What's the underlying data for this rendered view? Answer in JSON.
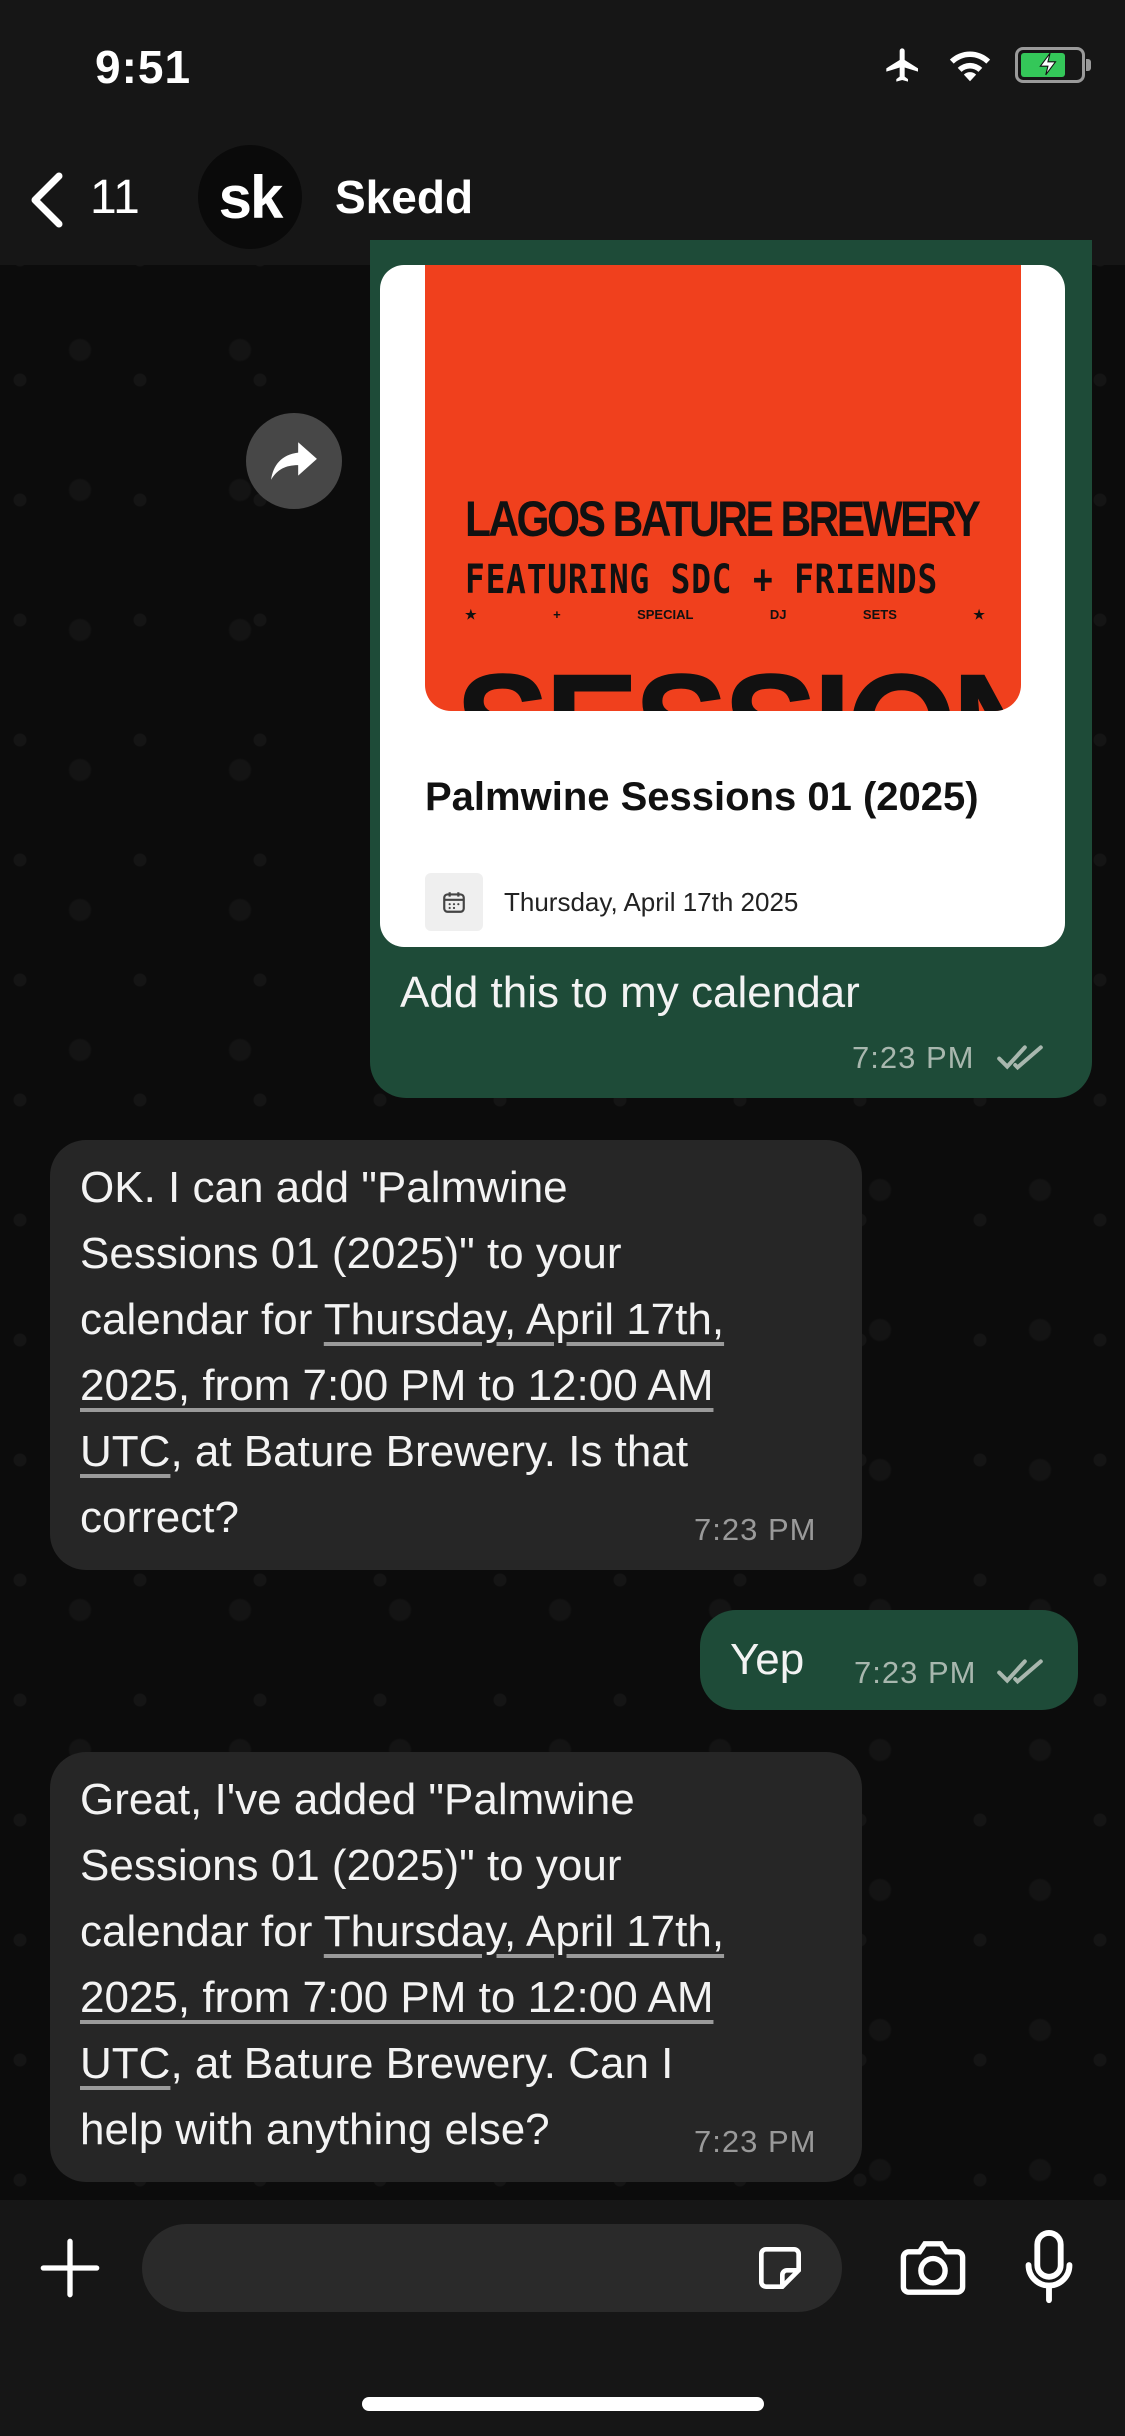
{
  "status_bar": {
    "time": "9:51"
  },
  "header": {
    "back_count": "11",
    "avatar_text": "sk",
    "contact_name": "Skedd"
  },
  "event_card": {
    "poster_lines": [
      "LAGOS BATURE BREWERY",
      "FEATURING SDC + FRIENDS",
      "SESSIONS"
    ],
    "poster_small": [
      "★",
      "+",
      "SPECIAL",
      "DJ",
      "SETS",
      "★"
    ],
    "title": "Palmwine Sessions 01 (2025)",
    "date": "Thursday, April 17th 2025"
  },
  "messages": [
    {
      "direction": "out",
      "text": "Add this to my calendar",
      "time": "7:23 PM"
    },
    {
      "direction": "in",
      "lines": [
        "OK. I can add \"Palmwine",
        "Sessions 01 (2025)\" to your",
        "calendar for ",
        "Thursday, April 17th,",
        "2025, from 7:00 PM to 12:00 AM",
        "UTC",
        ", at Bature Brewery. Is that",
        "correct?"
      ],
      "time": "7:23 PM"
    },
    {
      "direction": "out",
      "text": "Yep",
      "time": "7:23 PM"
    },
    {
      "direction": "in",
      "lines": [
        "Great, I've added \"Palmwine",
        "Sessions 01 (2025)\" to your",
        "calendar for ",
        "Thursday, April 17th,",
        "2025, from 7:00 PM to 12:00 AM",
        "UTC",
        ", at Bature Brewery. Can I",
        "help with anything else?"
      ],
      "time": "7:23 PM"
    }
  ],
  "icons": {
    "back": "chevron-left-icon",
    "forward": "forward-icon",
    "calendar": "calendar-icon",
    "plus": "plus-icon",
    "sticker": "sticker-icon",
    "camera": "camera-icon",
    "mic": "microphone-icon",
    "airplane": "airplane-icon",
    "wifi": "wifi-icon",
    "battery": "battery-charging-icon",
    "read": "double-check-icon"
  },
  "colors": {
    "outgoing_bubble": "#1e4b38",
    "incoming_bubble": "#262626",
    "poster": "#f0401d",
    "battery": "#34c759"
  }
}
